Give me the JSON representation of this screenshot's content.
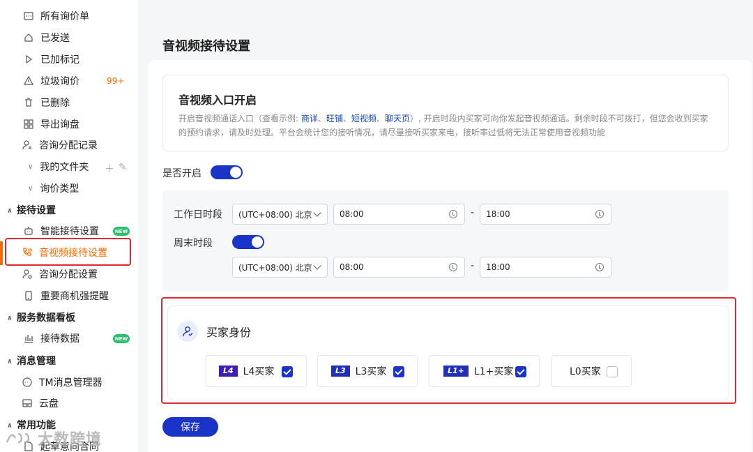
{
  "sidebar": {
    "items": [
      {
        "label": "所有询价单",
        "icon": "list-icon"
      },
      {
        "label": "已发送",
        "icon": "send-icon"
      },
      {
        "label": "已加标记",
        "icon": "flag-icon"
      },
      {
        "label": "垃圾询价",
        "icon": "warning-icon",
        "badge": "99+"
      },
      {
        "label": "已删除",
        "icon": "trash-icon"
      },
      {
        "label": "导出询盘",
        "icon": "export-icon"
      },
      {
        "label": "咨询分配记录",
        "icon": "user-assign-icon"
      },
      {
        "label": "我的文件夹",
        "icon": "chevron-down-icon"
      },
      {
        "label": "询价类型",
        "icon": "chevron-down-icon"
      }
    ],
    "groups": [
      {
        "title": "接待设置",
        "items": [
          {
            "label": "智能接待设置",
            "icon": "robot-icon",
            "badge": "NEW"
          },
          {
            "label": "音视频接待设置",
            "icon": "phone-video-icon",
            "active": true
          },
          {
            "label": "咨询分配设置",
            "icon": "user-settings-icon"
          },
          {
            "label": "重要商机强提醒",
            "icon": "mobile-icon"
          }
        ]
      },
      {
        "title": "服务数据看板",
        "items": [
          {
            "label": "接待数据",
            "icon": "bar-chart-icon",
            "badge": "NEW"
          }
        ]
      },
      {
        "title": "消息管理",
        "items": [
          {
            "label": "TM消息管理器",
            "icon": "message-icon"
          },
          {
            "label": "云盘",
            "icon": "cloud-disk-icon"
          }
        ]
      },
      {
        "title": "常用功能",
        "items": [
          {
            "label": "起草意向合同",
            "icon": "contract-icon"
          }
        ]
      }
    ],
    "watermark": "大数跨境"
  },
  "page": {
    "title": "音视频接待设置"
  },
  "intro": {
    "title": "音视频入口开启",
    "desc_before": "开启音视频通话入口（查看示例: ",
    "links": [
      "商详",
      "旺铺",
      "短视频",
      "聊天页"
    ],
    "desc_after": "）, 开启时段内买家可向你发起音视频通话。剩余时段不可拨打，但您会收到买家的预约请求，请及时处理。平台会统计您的接听情况，请尽量接听买家来电，接听率过低将无法正常使用音视频功能"
  },
  "enable": {
    "label": "是否开启",
    "on": true
  },
  "schedule": {
    "workday": {
      "label": "工作日时段",
      "timezone": "(UTC+08:00) 北京",
      "start": "08:00",
      "end": "18:00"
    },
    "weekend": {
      "label": "周末时段",
      "on": true,
      "timezone": "(UTC+08:00) 北京",
      "start": "08:00",
      "end": "18:00"
    },
    "separator": "-"
  },
  "buyer": {
    "title": "买家身份",
    "options": [
      {
        "level": "L4",
        "label": "L4买家",
        "checked": true
      },
      {
        "level": "L3",
        "label": "L3买家",
        "checked": true
      },
      {
        "level": "L1+",
        "label": "L1+买家",
        "checked": true
      },
      {
        "level": "",
        "label": "L0买家",
        "checked": false
      }
    ]
  },
  "actions": {
    "save_label": "保存"
  },
  "colors": {
    "accent": "#1a33c8",
    "active": "#ff6a00",
    "highlight": "#e0282e",
    "new_badge": "#2ac16a"
  }
}
